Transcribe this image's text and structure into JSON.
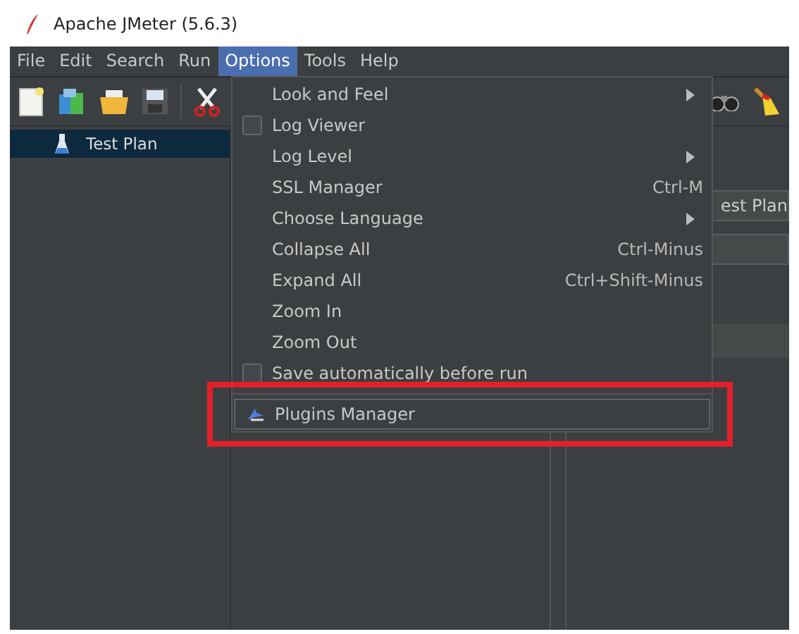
{
  "window": {
    "title": "Apache JMeter (5.6.3)"
  },
  "menubar": [
    {
      "label": "File",
      "selected": false
    },
    {
      "label": "Edit",
      "selected": false
    },
    {
      "label": "Search",
      "selected": false
    },
    {
      "label": "Run",
      "selected": false
    },
    {
      "label": "Options",
      "selected": true
    },
    {
      "label": "Tools",
      "selected": false
    },
    {
      "label": "Help",
      "selected": false
    }
  ],
  "tree": [
    {
      "label": "Test Plan",
      "selected": true
    }
  ],
  "name_field": {
    "value": "est Plan"
  },
  "options_menu": [
    {
      "kind": "submenu",
      "label": "Look and Feel",
      "selected": false
    },
    {
      "kind": "check",
      "label": "Log Viewer",
      "checked": false,
      "selected": false
    },
    {
      "kind": "submenu",
      "label": "Log Level",
      "selected": false
    },
    {
      "kind": "item",
      "label": "SSL Manager",
      "shortcut": "Ctrl-M",
      "selected": false
    },
    {
      "kind": "submenu",
      "label": "Choose Language",
      "selected": false
    },
    {
      "kind": "item",
      "label": "Collapse All",
      "shortcut": "Ctrl-Minus",
      "selected": false
    },
    {
      "kind": "item",
      "label": "Expand All",
      "shortcut": "Ctrl+Shift-Minus",
      "selected": false
    },
    {
      "kind": "item",
      "label": "Zoom In",
      "selected": false
    },
    {
      "kind": "item",
      "label": "Zoom Out",
      "selected": false
    },
    {
      "kind": "check",
      "label": "Save automatically before run",
      "checked": false,
      "selected": false
    },
    {
      "kind": "separator"
    },
    {
      "kind": "plugin",
      "label": "Plugins Manager",
      "selected": true
    }
  ],
  "red_box": true
}
